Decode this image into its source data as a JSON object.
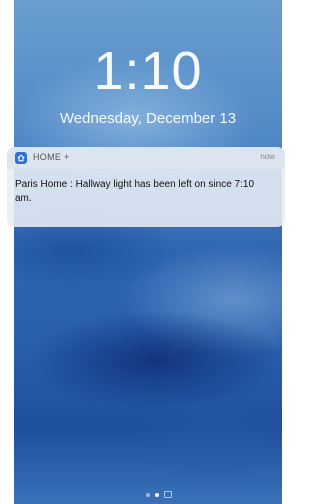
{
  "lockscreen": {
    "time": "1:10",
    "date": "Wednesday, December 13"
  },
  "notification": {
    "app_name": "HOME +",
    "app_icon": "home-icon",
    "time": "now",
    "message": "Paris Home : Hallway light has been left on since 7:10 am."
  },
  "page_indicator": {
    "pages": 3,
    "active_index": 1,
    "camera_icon": "camera-icon"
  },
  "colors": {
    "app_icon_bg": "#2f6fd6",
    "notification_bg": "#e8eef5"
  }
}
